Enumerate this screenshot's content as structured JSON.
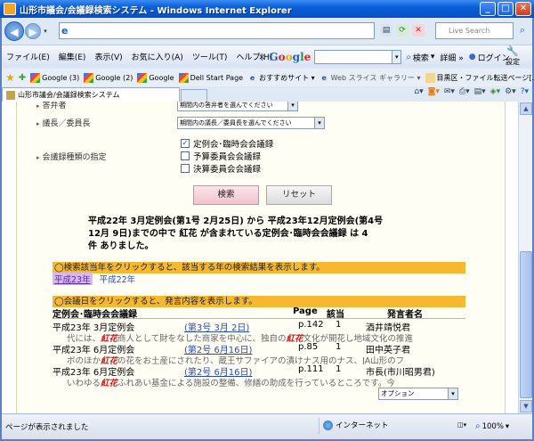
{
  "window": {
    "title": "山形市議会/会議録検索システム - Windows Internet Explorer",
    "minimize": "_",
    "maximize": "□",
    "close": "✕"
  },
  "address": {
    "url": "",
    "search_placeholder": "Live Search"
  },
  "menu": {
    "items": [
      "ファイル(E)",
      "編集(E)",
      "表示(V)",
      "お気に入り(A)",
      "ツール(T)",
      "ヘルプ(H)"
    ]
  },
  "google_toolbar": {
    "close": "×",
    "logo": [
      "G",
      "o",
      "o",
      "g",
      "l",
      "e"
    ],
    "search_label": "検索",
    "details_label": "詳細 »",
    "login_label": "ログイン",
    "settings_label": "設定"
  },
  "favorites": {
    "items": [
      {
        "label": "Google (3)",
        "icon": "google-icon"
      },
      {
        "label": "Google (2)",
        "icon": "google-icon"
      },
      {
        "label": "Google",
        "icon": "google-icon"
      },
      {
        "label": "Dell Start Page",
        "icon": "google-icon"
      },
      {
        "label": "おすすめサイト ▾",
        "icon": "ie-icon"
      },
      {
        "label": "Web スライス ギャラリー ▾",
        "icon": "ie-icon"
      },
      {
        "label": "目黒区・ファイル転送ページ[...",
        "icon": "page-icon"
      }
    ]
  },
  "tabs": {
    "active_label": "山形市議会/会議録検索システム"
  },
  "form": {
    "questioner_label": "答弁者",
    "questioner_select": "期間内の答弁者を選んでください",
    "chair_label": "議長／委員長",
    "chair_select": "期間内の議長／委員長を選んでください",
    "types_label": "会議録種類の指定",
    "types": [
      {
        "label": "定例会･臨時会会議録",
        "checked": true
      },
      {
        "label": "予算委員会会議録",
        "checked": false
      },
      {
        "label": "決算委員会会議録",
        "checked": false
      }
    ],
    "search_button": "検索",
    "reset_button": "リセット"
  },
  "summary": {
    "line1": "平成22年 3月定例会(第1号 2月25日)  から  平成23年12月定例会(第4号",
    "line2": "12月 9日)までの中で  紅花  が含まれている定例会･臨時会会議録  は  4",
    "line3": "件  ありました。"
  },
  "years_bar": {
    "text": "◯検索該当年をクリックすると、該当する年の検索結果を表示します。",
    "years": [
      "平成23年",
      "平成22年"
    ]
  },
  "results_bar": {
    "text": "◯会議日をクリックすると、発言内容を表示します。"
  },
  "table": {
    "headers": {
      "meeting": "定例会･臨時会会議録",
      "page": "Page",
      "count": "該当",
      "speaker": "発言者名"
    },
    "rows": [
      {
        "meeting": "平成23年 3月定例会",
        "date": "(第3号 3月 2日)",
        "page": "p.142",
        "count": "1",
        "speaker": "酒井靖悦君",
        "snippet_pre": "代には、",
        "snippet_hl": "紅花",
        "snippet_mid": "商人として財をなした商家を中心に、独自の",
        "snippet_hl2": "紅花",
        "snippet_post": "文化が開花し地域文化の推進"
      },
      {
        "meeting": "平成23年 6月定例会",
        "date": "(第2号 6月16日)",
        "page": "p.85",
        "count": "1",
        "speaker": "田中英子君",
        "snippet_pre": "ボのほか",
        "snippet_hl": "紅花",
        "snippet_mid": "の花をお土産にされたり、蔵王サファイアの漬けナス用のナス、JA山形のフ",
        "snippet_hl2": "",
        "snippet_post": ""
      },
      {
        "meeting": "平成23年 6月定例会",
        "date": "(第2号 6月16日)",
        "page": "p.111",
        "count": "1",
        "speaker": "市長(市川昭男君)",
        "snippet_pre": "いわゆる",
        "snippet_hl": "紅花",
        "snippet_mid": "ふれあい基金による施設の整備、修繕の助成を行っているところです。今",
        "snippet_hl2": "",
        "snippet_post": ""
      }
    ],
    "option_select": "オプション"
  },
  "status": {
    "text": "ページが表示されました",
    "zone": "インターネット",
    "zoom": "100%"
  }
}
